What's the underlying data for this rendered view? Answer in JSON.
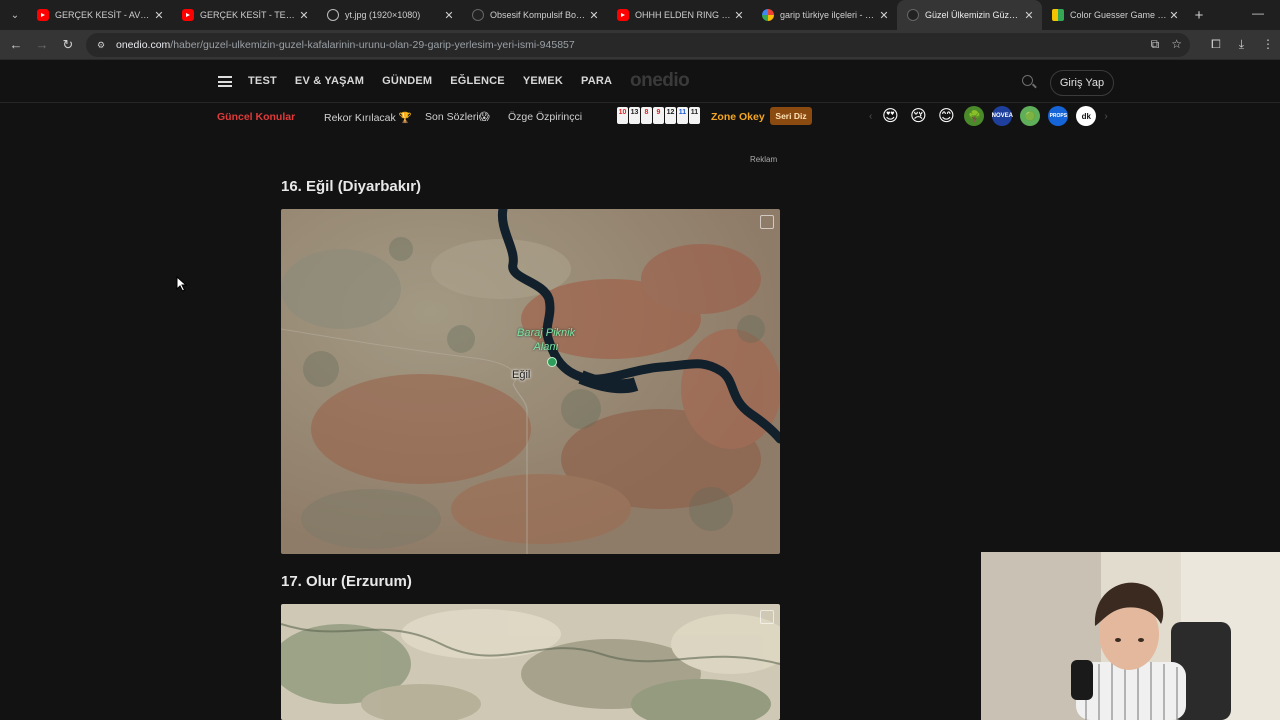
{
  "tabs": [
    {
      "title": "GERÇEK KESİT - AVCI - You",
      "favicon": "youtube-icon",
      "active": false
    },
    {
      "title": "GERÇEK KESİT - TEHLİKELİ",
      "favicon": "youtube-icon",
      "active": false
    },
    {
      "title": "yt.jpg (1920×1080)",
      "favicon": "globe-icon",
      "active": false
    },
    {
      "title": "Obsesif Kompulsif Bozukl",
      "favicon": "onedio-icon",
      "active": false
    },
    {
      "title": "OHHH ELDEN RING - You",
      "favicon": "youtube-icon",
      "active": false
    },
    {
      "title": "garip türkiye ilçeleri - Goo",
      "favicon": "google-icon",
      "active": false
    },
    {
      "title": "Güzel Ülkemizin Güzel Ka",
      "favicon": "onedio-icon",
      "active": true
    },
    {
      "title": "Color Guesser Game | Gu",
      "favicon": "colorguesser-icon",
      "active": false
    }
  ],
  "address_bar": {
    "host": "onedio.com",
    "path": "/haber/guzel-ulkemizin-guzel-kafalarinin-urunu-olan-29-garip-yerlesim-yeri-ismi-945857"
  },
  "site_nav": {
    "links": [
      "TEST",
      "EV & YAŞAM",
      "GÜNDEM",
      "EĞLENCE",
      "YEMEK",
      "PARA"
    ],
    "logo": "onedio",
    "login": "Giriş Yap"
  },
  "sub_nav": {
    "current_topics": "Güncel Konular",
    "topics": [
      "Rekor Kırılacak 🏆",
      "Son Sözleri😱",
      "Özge Özpirinçci"
    ],
    "okey_tiles": [
      "10",
      "13",
      "8",
      "9",
      "12",
      "11",
      "11"
    ],
    "zone_okey": "Zone Okey",
    "seri_diz": "Seri Diz",
    "reactions": [
      "😍",
      "😢",
      "😊",
      "🌳",
      "NOVEA",
      "🟢",
      "PROPS",
      "dk"
    ]
  },
  "article": {
    "ad_label": "Reklam",
    "items": [
      {
        "title": "16. Eğil (Diyarbakır)",
        "map_labels": [
          "Baraj Piknik",
          "Alanı"
        ],
        "town": "Eğil"
      },
      {
        "title": "17. Olur (Erzurum)"
      }
    ]
  }
}
